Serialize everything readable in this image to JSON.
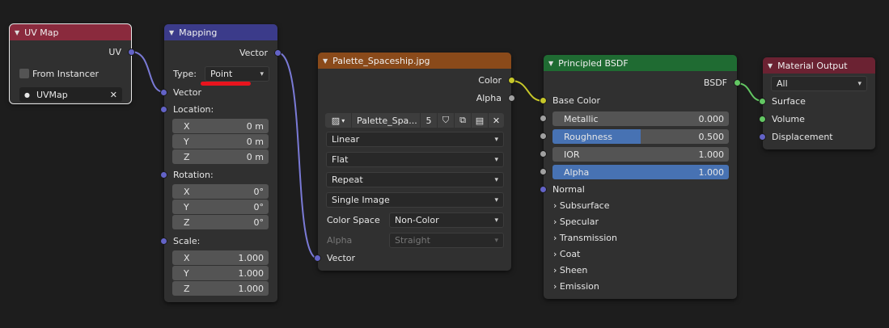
{
  "uv_map": {
    "title": "UV Map",
    "out_uv": "UV",
    "from_instancer": "From Instancer",
    "uvmap_name": "UVMap",
    "header_color": "#8a2a3d"
  },
  "mapping": {
    "title": "Mapping",
    "out_vector": "Vector",
    "type_label": "Type:",
    "type_value": "Point",
    "in_vector": "Vector",
    "location_label": "Location:",
    "location": [
      {
        "axis": "X",
        "value": "0 m"
      },
      {
        "axis": "Y",
        "value": "0 m"
      },
      {
        "axis": "Z",
        "value": "0 m"
      }
    ],
    "rotation_label": "Rotation:",
    "rotation": [
      {
        "axis": "X",
        "value": "0°"
      },
      {
        "axis": "Y",
        "value": "0°"
      },
      {
        "axis": "Z",
        "value": "0°"
      }
    ],
    "scale_label": "Scale:",
    "scale": [
      {
        "axis": "X",
        "value": "1.000"
      },
      {
        "axis": "Y",
        "value": "1.000"
      },
      {
        "axis": "Z",
        "value": "1.000"
      }
    ],
    "header_color": "#3b3b8a"
  },
  "image_texture": {
    "title": "Palette_Spaceship.jpg",
    "out_color": "Color",
    "out_alpha": "Alpha",
    "image_name": "Palette_Spa...",
    "users": "5",
    "interpolation": "Linear",
    "projection": "Flat",
    "extension": "Repeat",
    "source": "Single Image",
    "color_space_label": "Color Space",
    "color_space_value": "Non-Color",
    "alpha_label": "Alpha",
    "alpha_value": "Straight",
    "in_vector": "Vector",
    "header_color": "#8a4a1a"
  },
  "principled": {
    "title": "Principled BSDF",
    "out_bsdf": "BSDF",
    "base_color": "Base Color",
    "metallic_label": "Metallic",
    "metallic_value": "0.000",
    "roughness_label": "Roughness",
    "roughness_value": "0.500",
    "ior_label": "IOR",
    "ior_value": "1.000",
    "alpha_label": "Alpha",
    "alpha_value": "1.000",
    "normal": "Normal",
    "panels": [
      "Subsurface",
      "Specular",
      "Transmission",
      "Coat",
      "Sheen",
      "Emission"
    ],
    "header_color": "#1f6b32"
  },
  "output": {
    "title": "Material Output",
    "target": "All",
    "surface": "Surface",
    "volume": "Volume",
    "displacement": "Displacement",
    "header_color": "#6b2232"
  }
}
